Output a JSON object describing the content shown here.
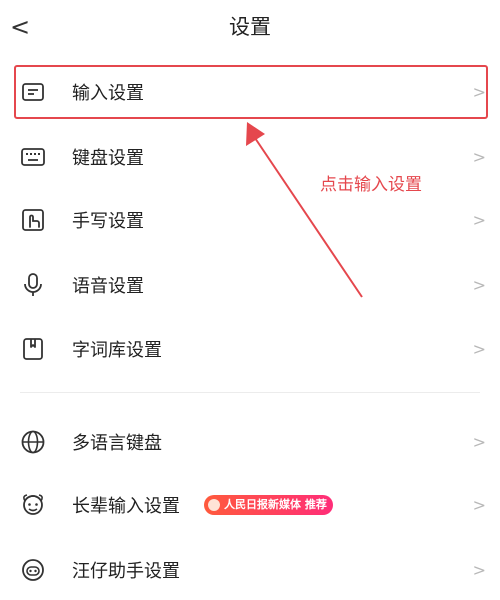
{
  "header": {
    "back_icon": "chevron-left-icon",
    "back_glyph": "<",
    "title": "设置"
  },
  "annotation": {
    "text": "点击输入设置",
    "color": "#e5474d"
  },
  "rows": [
    {
      "label": "输入设置",
      "icon": "input-settings-icon"
    },
    {
      "label": "键盘设置",
      "icon": "keyboard-icon"
    },
    {
      "label": "手写设置",
      "icon": "handwriting-icon"
    },
    {
      "label": "语音设置",
      "icon": "microphone-icon"
    },
    {
      "label": "字词库设置",
      "icon": "dictionary-icon"
    },
    {
      "label": "多语言键盘",
      "icon": "globe-icon"
    },
    {
      "label": "长辈输入设置",
      "icon": "elder-face-icon",
      "badge": "人民日报新媒体 推荐"
    },
    {
      "label": "汪仔助手设置",
      "icon": "assistant-icon"
    }
  ],
  "chevron": ">"
}
